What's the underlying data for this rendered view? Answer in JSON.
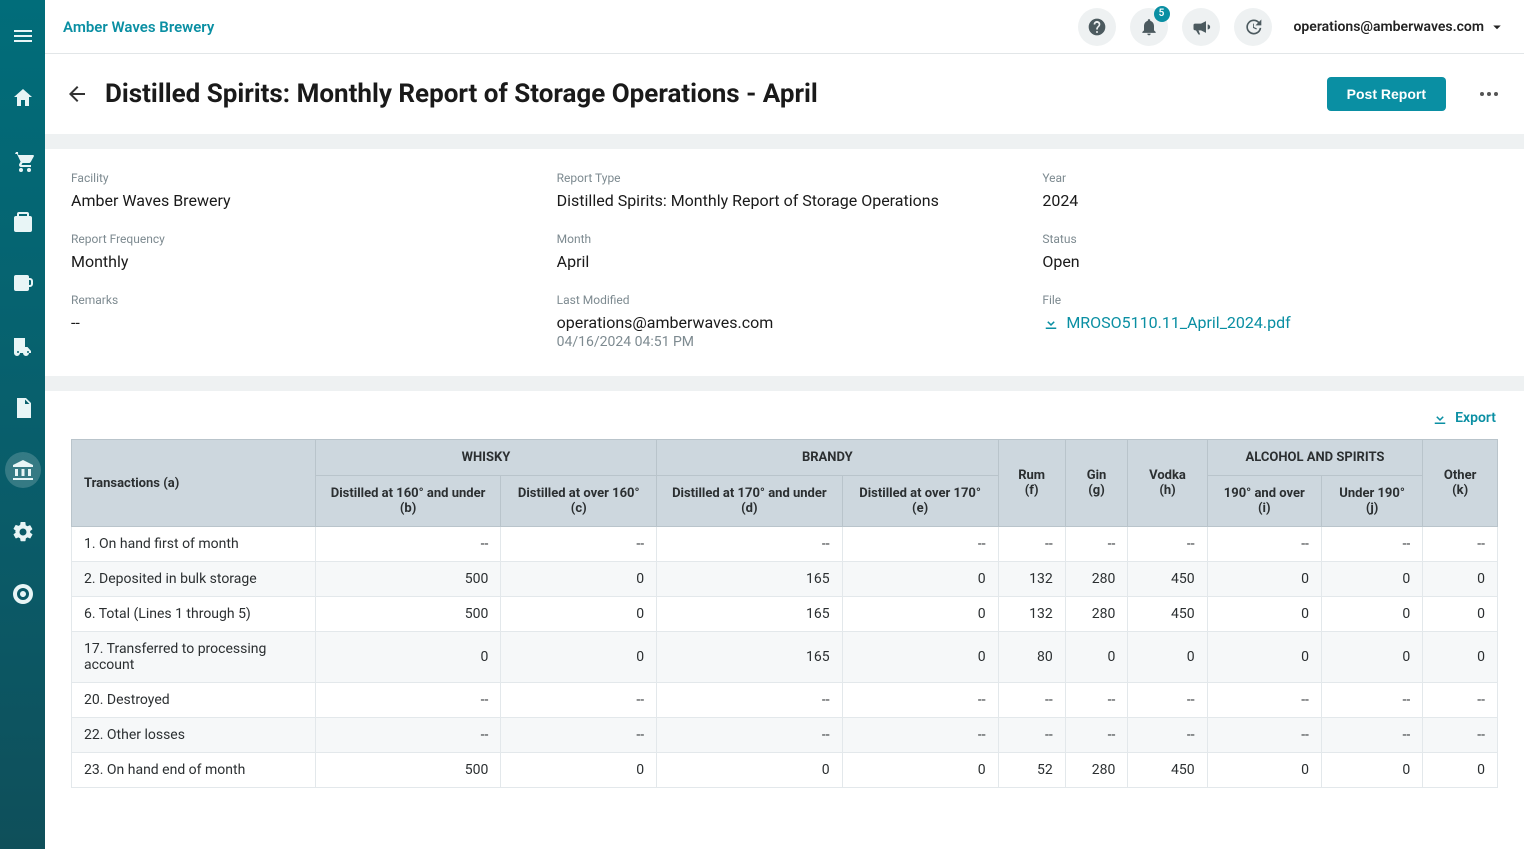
{
  "topbar": {
    "brand": "Amber Waves Brewery",
    "notification_count": "5",
    "user_email": "operations@amberwaves.com"
  },
  "header": {
    "title": "Distilled Spirits: Monthly Report of Storage Operations - April",
    "post_btn": "Post Report"
  },
  "details": {
    "facility_label": "Facility",
    "facility": "Amber Waves Brewery",
    "report_type_label": "Report Type",
    "report_type": "Distilled Spirits: Monthly Report of Storage Operations",
    "year_label": "Year",
    "year": "2024",
    "frequency_label": "Report Frequency",
    "frequency": "Monthly",
    "month_label": "Month",
    "month": "April",
    "status_label": "Status",
    "status": "Open",
    "remarks_label": "Remarks",
    "remarks": "--",
    "last_modified_label": "Last Modified",
    "last_modified_by": "operations@amberwaves.com",
    "last_modified_time": "04/16/2024 04:51 PM",
    "file_label": "File",
    "file_name": "MROSO5110.11_April_2024.pdf"
  },
  "export_label": "Export",
  "table": {
    "group_headers": {
      "transactions": "Transactions (a)",
      "whisky": "WHISKY",
      "brandy": "BRANDY",
      "alcohol": "ALCOHOL AND SPIRITS"
    },
    "columns": [
      "Distilled at 160° and under (b)",
      "Distilled at over 160° (c)",
      "Distilled at 170° and under (d)",
      "Distilled at over 170° (e)",
      "Rum (f)",
      "Gin (g)",
      "Vodka (h)",
      "190° and over (i)",
      "Under 190° (j)",
      "Other (k)"
    ],
    "rows": [
      {
        "label": "1. On hand first of month",
        "cells": [
          "--",
          "--",
          "--",
          "--",
          "--",
          "--",
          "--",
          "--",
          "--",
          "--"
        ]
      },
      {
        "label": "2. Deposited in bulk storage",
        "cells": [
          "500",
          "0",
          "165",
          "0",
          "132",
          "280",
          "450",
          "0",
          "0",
          "0"
        ]
      },
      {
        "label": "6. Total (Lines 1 through 5)",
        "cells": [
          "500",
          "0",
          "165",
          "0",
          "132",
          "280",
          "450",
          "0",
          "0",
          "0"
        ]
      },
      {
        "label": "17. Transferred to processing account",
        "cells": [
          "0",
          "0",
          "165",
          "0",
          "80",
          "0",
          "0",
          "0",
          "0",
          "0"
        ]
      },
      {
        "label": "20. Destroyed",
        "cells": [
          "--",
          "--",
          "--",
          "--",
          "--",
          "--",
          "--",
          "--",
          "--",
          "--"
        ]
      },
      {
        "label": "22. Other losses",
        "cells": [
          "--",
          "--",
          "--",
          "--",
          "--",
          "--",
          "--",
          "--",
          "--",
          "--"
        ]
      },
      {
        "label": "23. On hand end of month",
        "cells": [
          "500",
          "0",
          "0",
          "0",
          "52",
          "280",
          "450",
          "0",
          "0",
          "0"
        ]
      }
    ]
  }
}
